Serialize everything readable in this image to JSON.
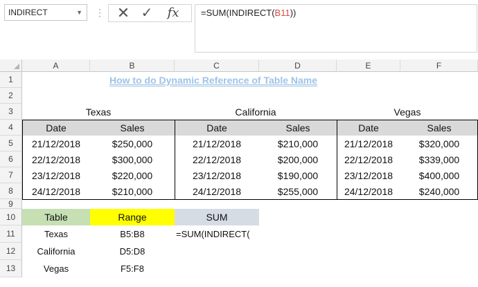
{
  "formula_bar": {
    "name_box": "INDIRECT",
    "formula_prefix": "=SUM(INDIRECT(",
    "formula_ref": "B11",
    "formula_suffix": "))"
  },
  "columns": [
    "A",
    "B",
    "C",
    "D",
    "E",
    "F"
  ],
  "rows": [
    "1",
    "2",
    "3",
    "4",
    "5",
    "6",
    "7",
    "8",
    "9",
    "10",
    "11",
    "12",
    "13"
  ],
  "title": "How to do Dynamic Reference of Table Name",
  "tables": [
    {
      "name": "Texas",
      "headers": [
        "Date",
        "Sales"
      ],
      "rows": [
        [
          "21/12/2018",
          "$250,000"
        ],
        [
          "22/12/2018",
          "$300,000"
        ],
        [
          "23/12/2018",
          "$220,000"
        ],
        [
          "24/12/2018",
          "$210,000"
        ]
      ]
    },
    {
      "name": "California",
      "headers": [
        "Date",
        "Sales"
      ],
      "rows": [
        [
          "21/12/2018",
          "$210,000"
        ],
        [
          "22/12/2018",
          "$200,000"
        ],
        [
          "23/12/2018",
          "$190,000"
        ],
        [
          "24/12/2018",
          "$255,000"
        ]
      ]
    },
    {
      "name": "Vegas",
      "headers": [
        "Date",
        "Sales"
      ],
      "rows": [
        [
          "21/12/2018",
          "$320,000"
        ],
        [
          "22/12/2018",
          "$339,000"
        ],
        [
          "23/12/2018",
          "$400,000"
        ],
        [
          "24/12/2018",
          "$240,000"
        ]
      ]
    }
  ],
  "lookup": {
    "headers": [
      "Table",
      "Range",
      "SUM"
    ],
    "rows": [
      [
        "Texas",
        "B5:B8",
        "=SUM(INDIRECT("
      ],
      [
        "California",
        "D5:D8",
        ""
      ],
      [
        "Vegas",
        "F5:F8",
        ""
      ]
    ]
  },
  "colors": {
    "title": "#9dc3e6",
    "header_fill": "#d9d9d9",
    "table_header": "#c6e0b4",
    "range_header": "#ffff00",
    "sum_header": "#d6dce4",
    "formula_ref": "#d94a4a"
  },
  "icons": {
    "cancel": "✕",
    "enter": "✓",
    "insert_function": "fx",
    "dropdown": "▼",
    "separator": "⋮"
  }
}
